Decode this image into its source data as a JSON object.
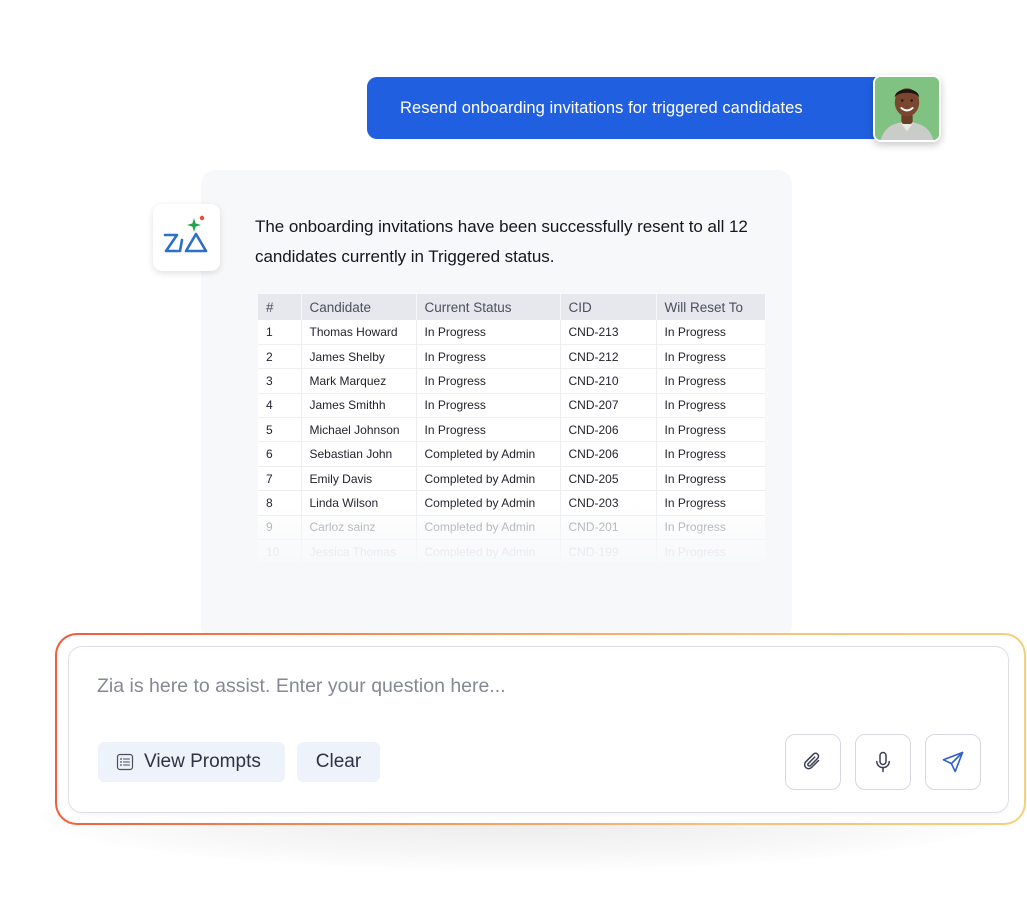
{
  "user_message": {
    "text": "Resend onboarding invitations for triggered candidates",
    "avatar_icon": "user-avatar"
  },
  "assistant": {
    "logo_text": "Zia",
    "logo_icon": "zia-logo-icon",
    "message": "The onboarding invitations have been successfully resent to all 12 candidates currently in Triggered status.",
    "table": {
      "headers": [
        "#",
        "Candidate",
        "Current Status",
        "CID",
        "Will Reset To"
      ],
      "rows": [
        [
          "1",
          "Thomas Howard",
          "In Progress",
          "CND-213",
          "In Progress"
        ],
        [
          "2",
          "James Shelby",
          "In Progress",
          "CND-212",
          "In Progress"
        ],
        [
          "3",
          "Mark Marquez",
          "In Progress",
          "CND-210",
          "In Progress"
        ],
        [
          "4",
          "James Smithh",
          "In Progress",
          "CND-207",
          "In Progress"
        ],
        [
          "5",
          "Michael Johnson",
          "In Progress",
          "CND-206",
          "In Progress"
        ],
        [
          "6",
          "Sebastian John",
          "Completed by Admin",
          "CND-206",
          "In Progress"
        ],
        [
          "7",
          "Emily Davis",
          "Completed by Admin",
          "CND-205",
          "In Progress"
        ],
        [
          "8",
          "Linda Wilson",
          "Completed by Admin",
          "CND-203",
          "In Progress"
        ],
        [
          "9",
          "Carloz sainz",
          "Completed by Admin",
          "CND-201",
          "In Progress"
        ],
        [
          "10",
          "Jessica Thomas",
          "Completed by Admin",
          "CND-199",
          "In Progress"
        ]
      ]
    }
  },
  "composer": {
    "placeholder": "Zia is here to assist. Enter your question here...",
    "value": "",
    "view_prompts_label": "View Prompts",
    "view_prompts_icon": "list-icon",
    "clear_label": "Clear",
    "attach_icon": "paperclip-icon",
    "mic_icon": "microphone-icon",
    "send_icon": "send-icon"
  },
  "colors": {
    "user_bubble": "#2060e0",
    "card_background": "#f7f8fa",
    "composer_glow_start": "#f25a3c",
    "composer_glow_end": "#f7cf7c",
    "button_background": "#eef3fb",
    "zia_blue": "#2d6ec9",
    "zia_green": "#1fa64a",
    "zia_red": "#e64a3b"
  }
}
